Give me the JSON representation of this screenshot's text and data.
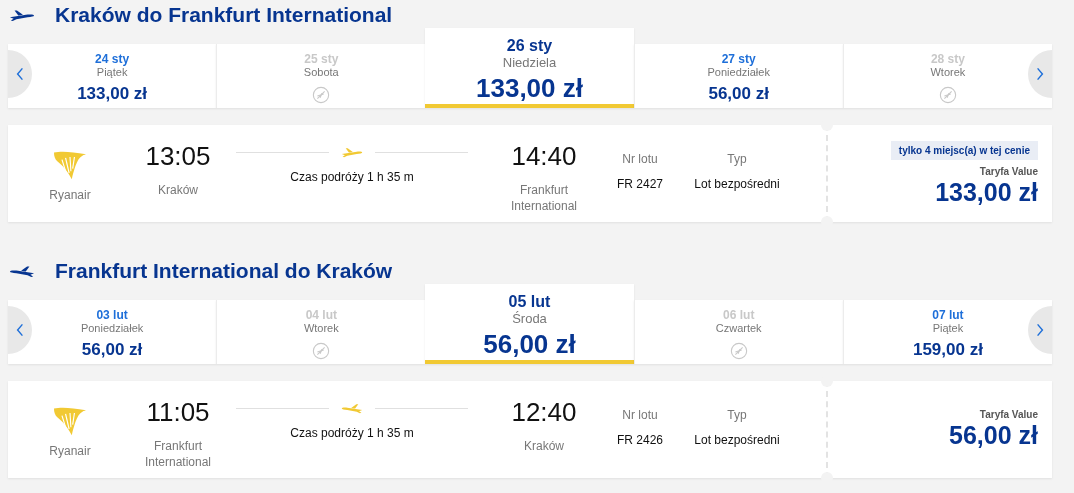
{
  "sections": [
    {
      "kind": "outbound",
      "title": "Kraków do Frankfurt International",
      "dates": [
        {
          "date": "24 sty",
          "day": "Piątek",
          "price": "133,00 zł",
          "available": true,
          "selected": false
        },
        {
          "date": "25 sty",
          "day": "Sobota",
          "available": false,
          "selected": false
        },
        {
          "date": "26 sty",
          "day": "Niedziela",
          "price": "133,00 zł",
          "available": true,
          "selected": true
        },
        {
          "date": "27 sty",
          "day": "Poniedziałek",
          "price": "56,00 zł",
          "available": true,
          "selected": false
        },
        {
          "date": "28 sty",
          "day": "Wtorek",
          "available": false,
          "selected": false
        }
      ],
      "flight": {
        "airline": "Ryanair",
        "departure_time": "13:05",
        "departure_airport": "Kraków",
        "duration": "Czas podróży 1 h 35 m",
        "arrival_time": "14:40",
        "arrival_airport": "Frankfurt International",
        "flight_number_label": "Nr lotu",
        "flight_number": "FR 2427",
        "type_label": "Typ",
        "type": "Lot bezpośredni",
        "seats_badge": "tylko 4 miejsc(a) w tej cenie",
        "fare_label": "Taryfa Value",
        "price": "133,00 zł"
      }
    },
    {
      "kind": "return",
      "title": "Frankfurt International do Kraków",
      "dates": [
        {
          "date": "03 lut",
          "day": "Poniedziałek",
          "price": "56,00 zł",
          "available": true,
          "selected": false
        },
        {
          "date": "04 lut",
          "day": "Wtorek",
          "available": false,
          "selected": false
        },
        {
          "date": "05 lut",
          "day": "Środa",
          "price": "56,00 zł",
          "available": true,
          "selected": true
        },
        {
          "date": "06 lut",
          "day": "Czwartek",
          "available": false,
          "selected": false
        },
        {
          "date": "07 lut",
          "day": "Piątek",
          "price": "159,00 zł",
          "available": true,
          "selected": false
        }
      ],
      "flight": {
        "airline": "Ryanair",
        "departure_time": "11:05",
        "departure_airport": "Frankfurt International",
        "duration": "Czas podróży 1 h 35 m",
        "arrival_time": "12:40",
        "arrival_airport": "Kraków",
        "flight_number_label": "Nr lotu",
        "flight_number": "FR 2426",
        "type_label": "Typ",
        "type": "Lot bezpośredni",
        "fare_label": "Taryfa Value",
        "price": "56,00 zł"
      }
    }
  ]
}
